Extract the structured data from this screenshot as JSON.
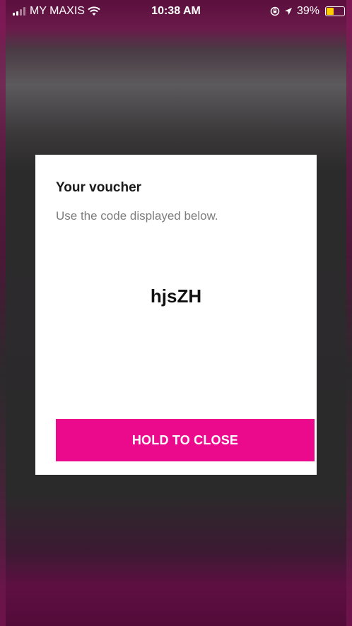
{
  "status_bar": {
    "carrier": "MY MAXIS",
    "time": "10:38 AM",
    "battery_percent": "39%",
    "battery_level": 0.39,
    "icons": [
      "signal-icon",
      "wifi-icon",
      "lock-rotation-icon",
      "location-icon",
      "battery-icon"
    ],
    "battery_color": "#ffcc00"
  },
  "modal": {
    "title": "Your voucher",
    "subtitle": "Use the code displayed below.",
    "code": "hjsZH",
    "close_label": "HOLD TO CLOSE"
  },
  "colors": {
    "accent": "#ec0a8c",
    "backdrop": "#2b2a2b",
    "brand_magenta": "#5e0f42"
  }
}
